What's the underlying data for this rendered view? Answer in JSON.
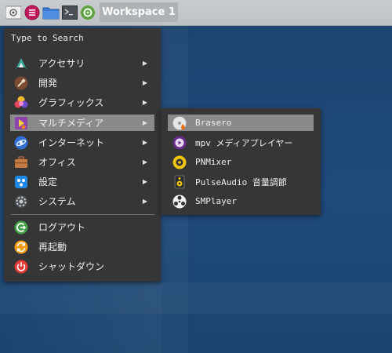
{
  "panel": {
    "workspace_label": "Workspace 1",
    "launchers": [
      {
        "icon": "app-menu-icon"
      },
      {
        "icon": "whisker-menu-icon"
      },
      {
        "icon": "folder-icon"
      },
      {
        "icon": "terminal-icon"
      },
      {
        "icon": "settings-icon"
      }
    ]
  },
  "menu": {
    "search_label": "Type to Search",
    "items": [
      {
        "label": "アクセサリ",
        "icon": "accessories-icon",
        "submenu": true
      },
      {
        "label": "開発",
        "icon": "development-icon",
        "submenu": true
      },
      {
        "label": "グラフィックス",
        "icon": "graphics-icon",
        "submenu": true
      },
      {
        "label": "マルチメディア",
        "icon": "multimedia-icon",
        "submenu": true,
        "selected": true
      },
      {
        "label": "インターネット",
        "icon": "internet-icon",
        "submenu": true
      },
      {
        "label": "オフィス",
        "icon": "office-icon",
        "submenu": true
      },
      {
        "label": "設定",
        "icon": "settings-icon",
        "submenu": true
      },
      {
        "label": "システム",
        "icon": "system-icon",
        "submenu": true
      }
    ],
    "session_items": [
      {
        "label": "ログアウト",
        "icon": "logout-icon"
      },
      {
        "label": "再起動",
        "icon": "restart-icon"
      },
      {
        "label": "シャットダウン",
        "icon": "shutdown-icon"
      }
    ],
    "arrow_glyph": "▶"
  },
  "submenu": {
    "items": [
      {
        "label": "Brasero",
        "icon": "brasero-icon",
        "selected": true
      },
      {
        "label": "mpv メディアプレイヤー",
        "icon": "mpv-icon"
      },
      {
        "label": "PNMixer",
        "icon": "pnmixer-icon"
      },
      {
        "label": "PulseAudio 音量調節",
        "icon": "pulseaudio-icon"
      },
      {
        "label": "SMPlayer",
        "icon": "smplayer-icon"
      }
    ]
  },
  "colors": {
    "menu_bg": "#363636",
    "selection_bg": "#8a8a8a",
    "panel_bg": "#c4c7c9",
    "desktop_bg": "#1f4a7d"
  }
}
